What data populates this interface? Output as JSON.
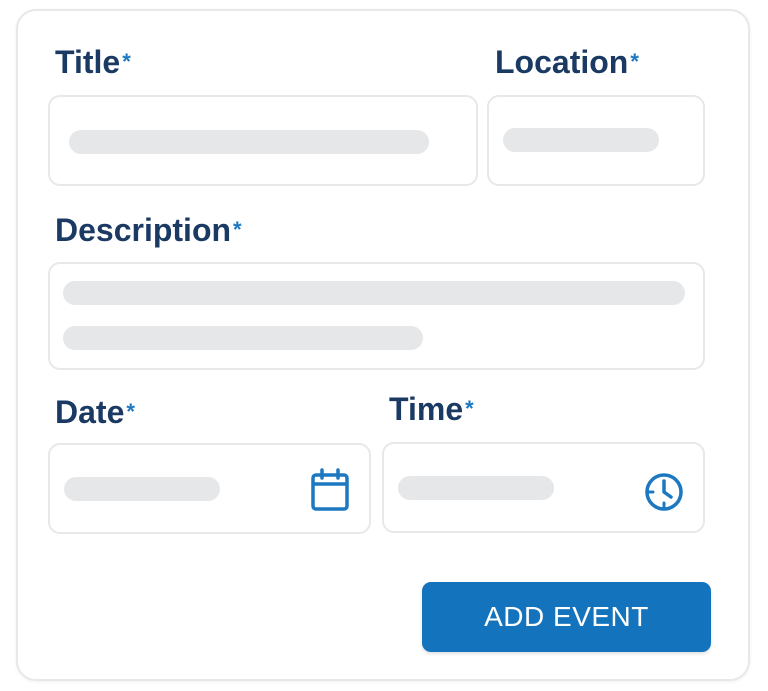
{
  "form": {
    "required_marker": "*",
    "title_label": "Title",
    "location_label": "Location",
    "description_label": "Description",
    "date_label": "Date",
    "time_label": "Time",
    "submit_label": "ADD EVENT"
  },
  "icons": {
    "date": "calendar-icon",
    "time": "clock-icon"
  },
  "colors": {
    "label": "#1b3a63",
    "required": "#1c78c0",
    "accent": "#1473bd",
    "placeholder_bar": "#e6e7e9",
    "border": "#e6e8ea"
  }
}
